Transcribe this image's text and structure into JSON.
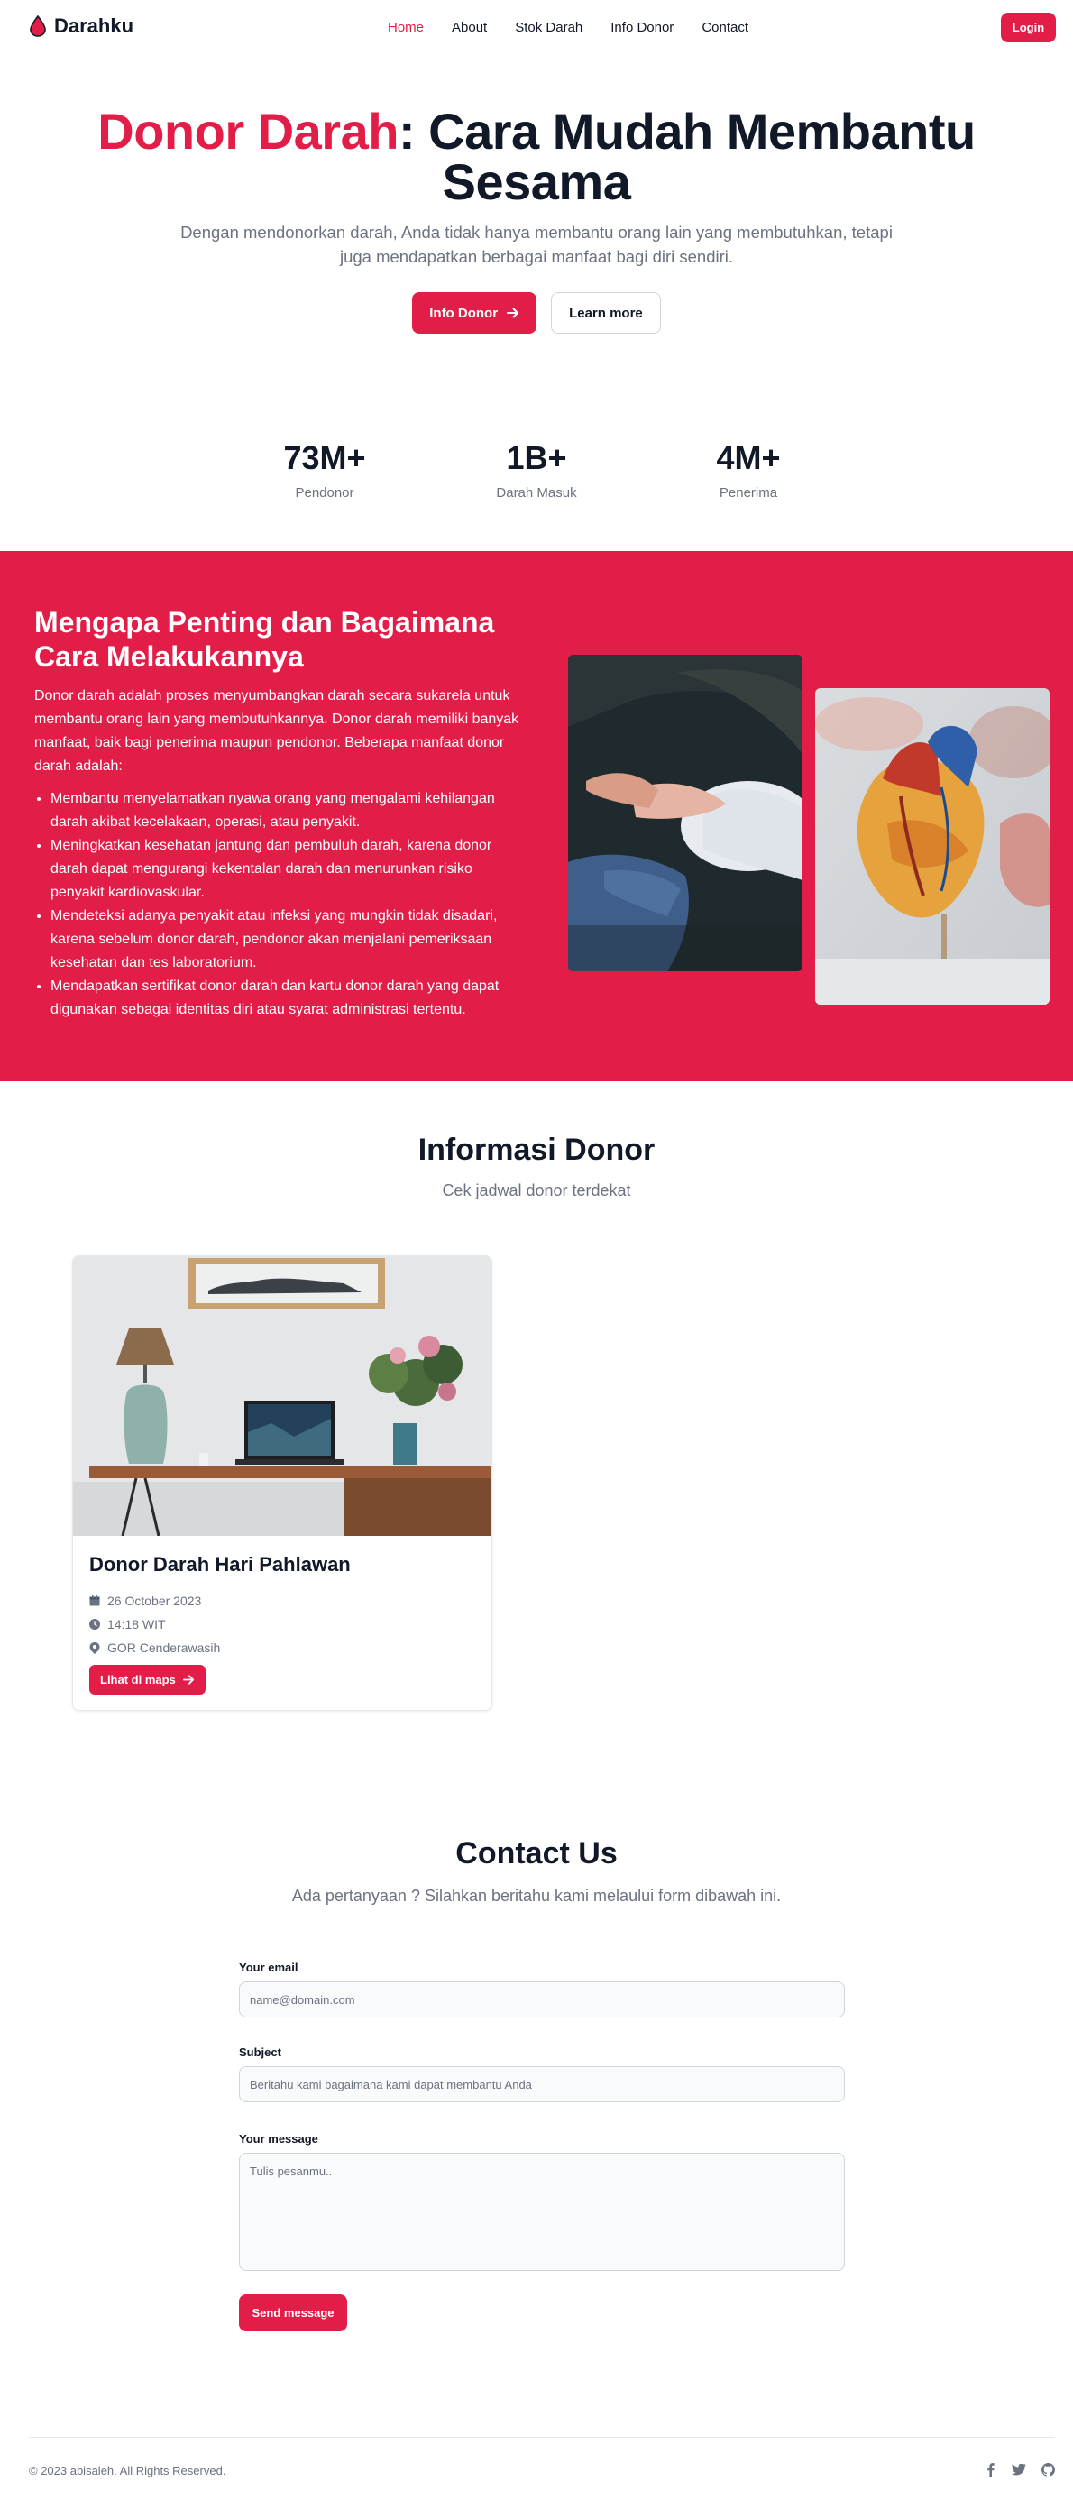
{
  "brand": {
    "name": "Darahku"
  },
  "nav": {
    "links": [
      "Home",
      "About",
      "Stok Darah",
      "Info Donor",
      "Contact"
    ],
    "active": "Home",
    "login_label": "Login"
  },
  "hero": {
    "title_accent": "Donor Darah",
    "title_rest": ": Cara Mudah Membantu Sesama",
    "subtitle": "Dengan mendonorkan darah, Anda tidak hanya membantu orang lain yang membutuhkan, tetapi juga mendapatkan berbagai manfaat bagi diri sendiri.",
    "primary_button": "Info Donor",
    "secondary_button": "Learn more"
  },
  "stats": [
    {
      "value": "73M+",
      "label": "Pendonor"
    },
    {
      "value": "1B+",
      "label": "Darah Masuk"
    },
    {
      "value": "4M+",
      "label": "Penerima"
    }
  ],
  "why": {
    "title": "Mengapa Penting dan Bagaimana Cara Melakukannya",
    "description": "Donor darah adalah proses menyumbangkan darah secara sukarela untuk membantu orang lain yang membutuhkannya. Donor darah memiliki banyak manfaat, baik bagi penerima maupun pendonor. Beberapa manfaat donor darah adalah:",
    "benefits": [
      "Membantu menyelamatkan nyawa orang yang mengalami kehilangan darah akibat kecelakaan, operasi, atau penyakit.",
      "Meningkatkan kesehatan jantung dan pembuluh darah, karena donor darah dapat mengurangi kekentalan darah dan menurunkan risiko penyakit kardiovaskular.",
      "Mendeteksi adanya penyakit atau infeksi yang mungkin tidak disadari, karena sebelum donor darah, pendonor akan menjalani pemeriksaan kesehatan dan tes laboratorium.",
      "Mendapatkan sertifikat donor darah dan kartu donor darah yang dapat digunakan sebagai identitas diri atau syarat administrasi tertentu."
    ]
  },
  "info_donor": {
    "title": "Informasi Donor",
    "subtitle": "Cek jadwal donor terdekat",
    "cards": [
      {
        "title": "Donor Darah Hari Pahlawan",
        "date": "26 October 2023",
        "time": "14:18 WIT",
        "location": "GOR Cenderawasih",
        "button": "Lihat di maps"
      }
    ]
  },
  "contact": {
    "title": "Contact Us",
    "subtitle": "Ada pertanyaan ? Silahkan beritahu kami melaului form dibawah ini.",
    "email_label": "Your email",
    "email_placeholder": "name@domain.com",
    "subject_label": "Subject",
    "subject_placeholder": "Beritahu kami bagaimana kami dapat membantu Anda",
    "message_label": "Your message",
    "message_placeholder": "Tulis pesanmu..",
    "send_label": "Send message"
  },
  "footer": {
    "copyright": "© 2023 abisaleh. All Rights Reserved.",
    "icons": [
      "facebook-icon",
      "twitter-icon",
      "github-icon"
    ]
  },
  "colors": {
    "accent": "#e11d48",
    "text": "#111827",
    "muted": "#6b7280"
  }
}
